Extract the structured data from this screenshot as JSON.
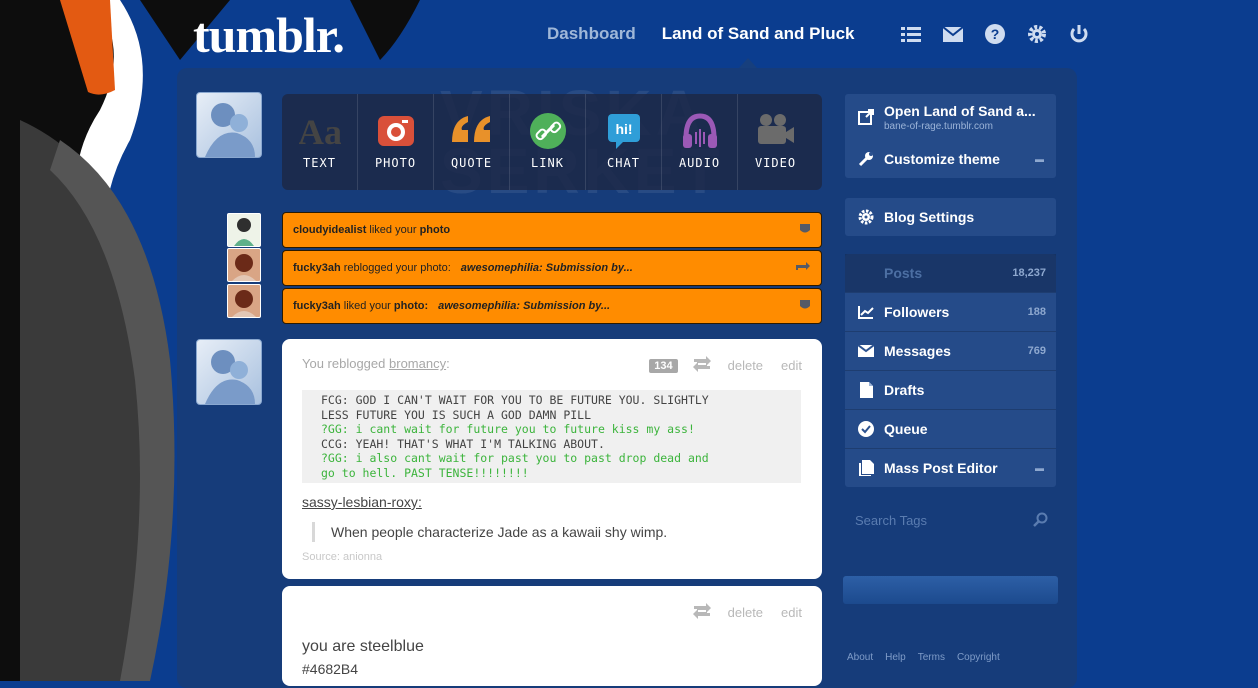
{
  "brand": {
    "logo": "tumblr."
  },
  "topnav": {
    "dashboard": "Dashboard",
    "blog_name": "Land of Sand and Pluck",
    "icons": [
      "list-icon",
      "mail-icon",
      "help-icon",
      "gear-icon",
      "power-icon"
    ]
  },
  "background": {
    "watermark_line1": "VRISKA",
    "watermark_line2": "SERKET"
  },
  "post_types": [
    {
      "label": "TEXT",
      "icon": "text-icon",
      "color": "#444444"
    },
    {
      "label": "PHOTO",
      "icon": "camera-icon",
      "color": "#d9503a"
    },
    {
      "label": "QUOTE",
      "icon": "quote-icon",
      "color": "#e8912a"
    },
    {
      "label": "LINK",
      "icon": "link-icon",
      "color": "#4fb05a"
    },
    {
      "label": "CHAT",
      "icon": "chat-icon",
      "color": "#2f9ed8"
    },
    {
      "label": "AUDIO",
      "icon": "headphones-icon",
      "color": "#9b59b6"
    },
    {
      "label": "VIDEO",
      "icon": "video-icon",
      "color": "#6b6b6b"
    }
  ],
  "activity": [
    {
      "user": "cloudyidealist",
      "action": "liked your",
      "object": "photo",
      "post": "",
      "icon": "heart-icon"
    },
    {
      "user": "fucky3ah",
      "action": "reblogged your photo:",
      "object": "",
      "post": "awesomephilia: Submission by...",
      "icon": "reblog-icon"
    },
    {
      "user": "fucky3ah",
      "action": "liked your",
      "object": "photo:",
      "post": "awesomephilia: Submission by...",
      "icon": "heart-icon"
    }
  ],
  "post1": {
    "header_prefix": "You reblogged",
    "header_user": "bromancy",
    "header_suffix": ":",
    "notes": "134",
    "delete": "delete",
    "edit": "edit",
    "chat_lines": [
      {
        "text": "FCG: GOD I CAN'T WAIT FOR YOU TO BE FUTURE YOU. SLIGHTLY",
        "green": false
      },
      {
        "text": "LESS FUTURE YOU IS SUCH A GOD DAMN PILL",
        "green": false
      },
      {
        "text": "?GG: i cant wait for future you to future kiss my ass!",
        "green": true
      },
      {
        "text": "CCG: YEAH! THAT'S WHAT I'M TALKING ABOUT.",
        "green": false
      },
      {
        "text": "?GG: i also cant wait for past you to past drop dead and",
        "green": true
      },
      {
        "text": "go to hell. PAST TENSE!!!!!!!!",
        "green": true
      }
    ],
    "source_user": "sassy-lesbian-roxy",
    "source_user_suffix": ":",
    "quote": "When people characterize Jade as a kawaii shy wimp.",
    "source": "Source: anionna"
  },
  "post2": {
    "delete": "delete",
    "edit": "edit",
    "text": "you are steelblue",
    "hex": "#4682B4"
  },
  "sidebar": {
    "open_blog": "Open Land of Sand a...",
    "open_blog_url": "bane-of-rage.tumblr.com",
    "customize": "Customize theme",
    "blog_settings": "Blog Settings",
    "posts": "Posts",
    "posts_count": "18,237",
    "followers": "Followers",
    "followers_count": "188",
    "messages": "Messages",
    "messages_count": "769",
    "drafts": "Drafts",
    "queue": "Queue",
    "mass_post": "Mass Post Editor",
    "search_placeholder": "Search Tags"
  },
  "footer": {
    "about": "About",
    "help": "Help",
    "terms": "Terms",
    "copyright": "Copyright"
  }
}
